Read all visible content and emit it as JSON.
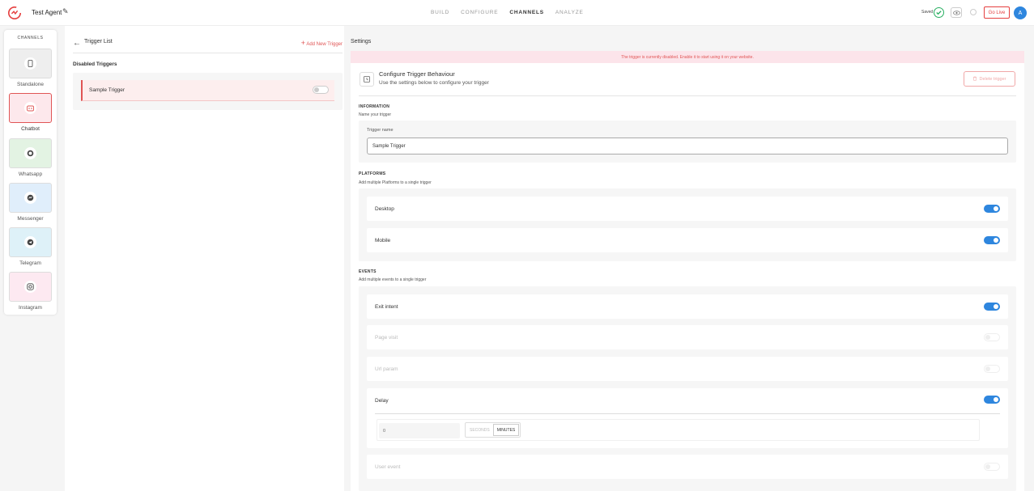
{
  "header": {
    "agent_name": "Test Agent",
    "nav": [
      "BUILD",
      "CONFIGURE",
      "CHANNELS",
      "ANALYZE"
    ],
    "active_nav": "CHANNELS",
    "saved_label": "Saved",
    "go_live_label": "Go Live",
    "avatar_initial": "A",
    "accent_color": "#e53e3e",
    "brand_color": "#2e86de"
  },
  "channels": {
    "title": "CHANNELS",
    "items": [
      {
        "label": "Standalone",
        "icon": "phone-icon",
        "bg": "#eeeeee",
        "active": false
      },
      {
        "label": "Chatbot",
        "icon": "chatbot-icon",
        "bg": "#fde8ec",
        "active": true
      },
      {
        "label": "Whatsapp",
        "icon": "whatsapp-icon",
        "bg": "#e3f3e3",
        "active": false
      },
      {
        "label": "Messenger",
        "icon": "messenger-icon",
        "bg": "#e0eefb",
        "active": false
      },
      {
        "label": "Telegram",
        "icon": "telegram-icon",
        "bg": "#def1f8",
        "active": false
      },
      {
        "label": "Instagram",
        "icon": "instagram-icon",
        "bg": "#fde9f1",
        "active": false
      }
    ]
  },
  "trigger_list": {
    "title": "Trigger List",
    "add_label": "Add New Trigger",
    "disabled_heading": "Disabled Triggers",
    "items": [
      {
        "name": "Sample Trigger",
        "enabled": false
      }
    ]
  },
  "settings": {
    "heading": "Settings",
    "banner": "The trigger is currently disabled. Enable it to start using it on your website.",
    "title": "Configure Trigger Behaviour",
    "subtitle": "Use the settings below to configure your trigger",
    "delete_label": "Delete trigger",
    "information": {
      "title": "INFORMATION",
      "subtitle": "Name your trigger",
      "field_label": "Trigger name",
      "field_value": "Sample Trigger"
    },
    "platforms": {
      "title": "PLATFORMS",
      "subtitle": "Add multiple Platforms to a single trigger",
      "items": [
        {
          "label": "Desktop",
          "enabled": true
        },
        {
          "label": "Mobile",
          "enabled": true
        }
      ]
    },
    "events": {
      "title": "EVENTS",
      "subtitle": "Add multiple events to a single trigger",
      "exit_intent": {
        "label": "Exit intent",
        "enabled": true
      },
      "page_visit": {
        "label": "Page visit",
        "enabled": false
      },
      "url_param": {
        "label": "Url param",
        "enabled": false
      },
      "delay": {
        "label": "Delay",
        "enabled": true,
        "value": "0",
        "units": [
          "SECONDS",
          "MINUTES"
        ],
        "selected_unit": "MINUTES"
      },
      "user_event": {
        "label": "User event",
        "enabled": false
      }
    }
  }
}
